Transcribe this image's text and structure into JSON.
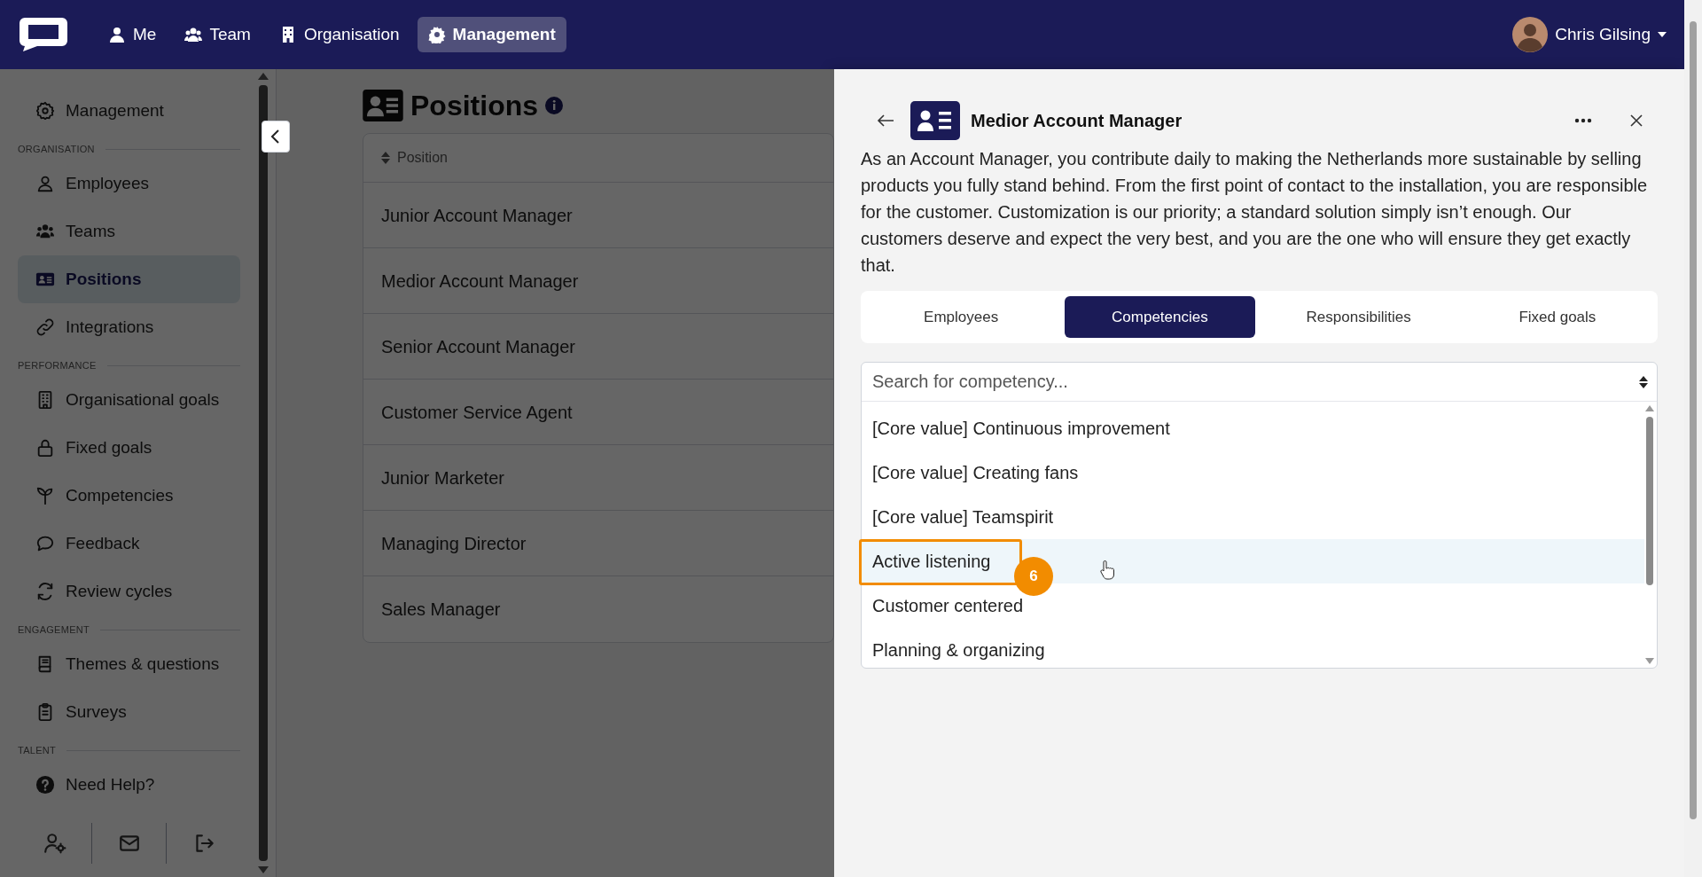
{
  "nav": {
    "items": [
      {
        "label": "Me",
        "selected": false
      },
      {
        "label": "Team",
        "selected": false
      },
      {
        "label": "Organisation",
        "selected": false
      },
      {
        "label": "Management",
        "selected": true
      }
    ],
    "user": {
      "name": "Chris Gilsing"
    }
  },
  "sidebar": {
    "sections": [
      {
        "items": [
          {
            "label": "Management",
            "selected": false
          }
        ]
      },
      {
        "title": "ORGANISATION",
        "items": [
          {
            "label": "Employees",
            "selected": false
          },
          {
            "label": "Teams",
            "selected": false
          },
          {
            "label": "Positions",
            "selected": true
          },
          {
            "label": "Integrations",
            "selected": false
          }
        ]
      },
      {
        "title": "PERFORMANCE",
        "items": [
          {
            "label": "Organisational goals",
            "selected": false
          },
          {
            "label": "Fixed goals",
            "selected": false
          },
          {
            "label": "Competencies",
            "selected": false
          },
          {
            "label": "Feedback",
            "selected": false
          },
          {
            "label": "Review cycles",
            "selected": false
          }
        ]
      },
      {
        "title": "ENGAGEMENT",
        "items": [
          {
            "label": "Themes & questions",
            "selected": false
          },
          {
            "label": "Surveys",
            "selected": false
          }
        ]
      },
      {
        "title": "TALENT",
        "items": [
          {
            "label": "Need Help?",
            "selected": false
          }
        ]
      }
    ]
  },
  "page": {
    "title": "Positions",
    "table": {
      "columns": [
        "Position"
      ],
      "rows": [
        "Junior Account Manager",
        "Medior Account Manager",
        "Senior Account Manager",
        "Customer Service Agent",
        "Junior Marketer",
        "Managing Director",
        "Sales Manager"
      ]
    }
  },
  "panel": {
    "title": "Medior Account Manager",
    "description": "As an Account Manager, you contribute daily to making the Netherlands more sustainable by selling products you fully stand behind. From the first point of contact to the installation, you are responsible for the customer. Customization is our priority; a standard solution simply isn’t enough. Our customers deserve and expect the very best, and you are the one who will ensure they get exactly that.",
    "tabs": [
      {
        "label": "Employees",
        "selected": false
      },
      {
        "label": "Competencies",
        "selected": true
      },
      {
        "label": "Responsibilities",
        "selected": false
      },
      {
        "label": "Fixed goals",
        "selected": false
      }
    ],
    "search": {
      "placeholder": "Search for competency..."
    },
    "options": [
      {
        "label": "[Core value] Continuous improvement",
        "highlighted": false
      },
      {
        "label": "[Core value] Creating fans",
        "highlighted": false
      },
      {
        "label": "[Core value] Teamspirit",
        "highlighted": false
      },
      {
        "label": "Active listening",
        "highlighted": true,
        "callout": "6"
      },
      {
        "label": "Customer centered",
        "highlighted": false
      },
      {
        "label": "Planning & organizing",
        "highlighted": false
      }
    ]
  }
}
